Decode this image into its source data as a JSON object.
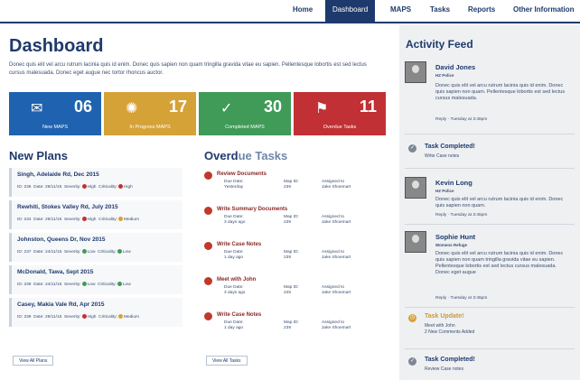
{
  "nav": {
    "home": "Home",
    "dashboard": "Dashboard",
    "maps": "MAPS",
    "tasks": "Tasks",
    "reports": "Reports",
    "other": "Other Information"
  },
  "page": {
    "title": "Dashboard",
    "lead": "Donec quis elit vel arcu rutrum lacinia quis id enim. Donec quis sapien non quam tringilla gravida vitae eu sapien. Pellentesque lobortis est sed lectus cursus malesuada. Donec eget augue nec tortor rhoncus auctor."
  },
  "tiles": [
    {
      "value": "06",
      "label": "New MAPS",
      "color": "#1f62b0",
      "icon": "map-icon",
      "glyph": "✉"
    },
    {
      "value": "17",
      "label": "In Progress MAPS",
      "color": "#d5a238",
      "icon": "spinner-icon",
      "glyph": "✺"
    },
    {
      "value": "30",
      "label": "Completed MAPS",
      "color": "#3f9b57",
      "icon": "check-icon",
      "glyph": "✓"
    },
    {
      "value": "11",
      "label": "Overdue Tasks",
      "color": "#c13034",
      "icon": "flag-icon",
      "glyph": "⚑"
    }
  ],
  "new_plans": {
    "heading": "New Plans",
    "items": [
      {
        "title": "Singh, Adelaide Rd, Dec 2015",
        "id": "ID: 236",
        "date": "Date: 29/11/15",
        "severity": "Severity:",
        "severity_value": "High",
        "severity_color": "#c13034",
        "criticality": "Criticality:",
        "criticality_value": "High",
        "criticality_color": "#c13034"
      },
      {
        "title": "Rewhiti, Stokes Valley Rd, July 2015",
        "id": "ID: 234",
        "date": "Date: 29/11/15",
        "severity": "Severity:",
        "severity_value": "High",
        "severity_color": "#c13034",
        "criticality": "Criticality:",
        "criticality_value": "Medium",
        "criticality_color": "#d5a238"
      },
      {
        "title": "Johnston, Queens Dr, Nov 2015",
        "id": "ID: 237",
        "date": "Date: 24/11/15",
        "severity": "Severity:",
        "severity_value": "Low",
        "severity_color": "#3f9b57",
        "criticality": "Criticality:",
        "criticality_value": "Low",
        "criticality_color": "#3f9b57"
      },
      {
        "title": "McDonald, Tawa, Sept 2015",
        "id": "ID: 239",
        "date": "Date: 24/11/15",
        "severity": "Severity:",
        "severity_value": "Low",
        "severity_color": "#3f9b57",
        "criticality": "Criticality:",
        "criticality_value": "Low",
        "criticality_color": "#3f9b57"
      },
      {
        "title": "Casey, Makia Vale Rd, Apr 2015",
        "id": "ID: 239",
        "date": "Date: 29/11/15",
        "severity": "Severity:",
        "severity_value": "High",
        "severity_color": "#c13034",
        "criticality": "Criticality:",
        "criticality_value": "Medium",
        "criticality_color": "#d5a238"
      }
    ],
    "button": "View All Plans"
  },
  "overdue": {
    "heading_a": "Overd",
    "heading_b": "ue Tasks",
    "col_due": "Due Date:",
    "col_map": "Map ID:",
    "col_assigned": "Assigned to",
    "items": [
      {
        "title": "Review Documents",
        "due": "Yesterday",
        "map": "239",
        "assigned": "Jake Shoemart"
      },
      {
        "title": "Write Summary Documents",
        "due": "3 days ago",
        "map": "239",
        "assigned": "Jake Shoemart"
      },
      {
        "title": "Write Case Notes",
        "due": "1 day ago",
        "map": "239",
        "assigned": "Jake Shoemart"
      },
      {
        "title": "Meet with John",
        "due": "3 days ago",
        "map": "245",
        "assigned": "Jake Shoemart"
      },
      {
        "title": "Write Case Notes",
        "due": "1 day ago",
        "map": "239",
        "assigned": "Jake Shoemart"
      }
    ],
    "button": "View All Tasks"
  },
  "activity": {
    "heading": "Activity Feed",
    "posts": [
      {
        "name": "David Jones",
        "role": "HZ Police",
        "body": "Donec quis elit vel arcu rutrum lacinia quis id enim. Donec quis sapien non quam. Pellentesque lobortis est sed lectus cursus malesuada.",
        "reply": "Reply · Tuesday at 3:46pm"
      },
      {
        "name": "Kevin Long",
        "role": "HZ Police",
        "body": "Donec quis elit vel arcu rutrum lacinia quis id enim. Donec quis sapien non quam.",
        "reply": "Reply · Tuesday at 3:46pm"
      },
      {
        "name": "Sophie Hunt",
        "role": "Womens Refuge",
        "body": "Donec quis elit vel arcu rutrum lacinia quis id enim. Donec quis sapien non quam tringilla gravida vitae eu sapien. Pellentesque lobortis est sed lectus cursus malesuada. Donec eget augue",
        "reply": "Reply · Tuesday at 3:46pm"
      }
    ],
    "events": [
      {
        "title": "Task Completed!",
        "sub": "Write Case notes",
        "icon": "check-icon",
        "glyph": "✓",
        "color": "#7d8793"
      },
      {
        "title": "Task Update!",
        "sub": "Meet with John\n2 New Comments Added",
        "icon": "clock-icon",
        "glyph": "◷",
        "color": "#d5a238"
      },
      {
        "title": "Task Completed!",
        "sub": "Review Case notes",
        "icon": "check-icon",
        "glyph": "✓",
        "color": "#7d8793"
      }
    ]
  }
}
